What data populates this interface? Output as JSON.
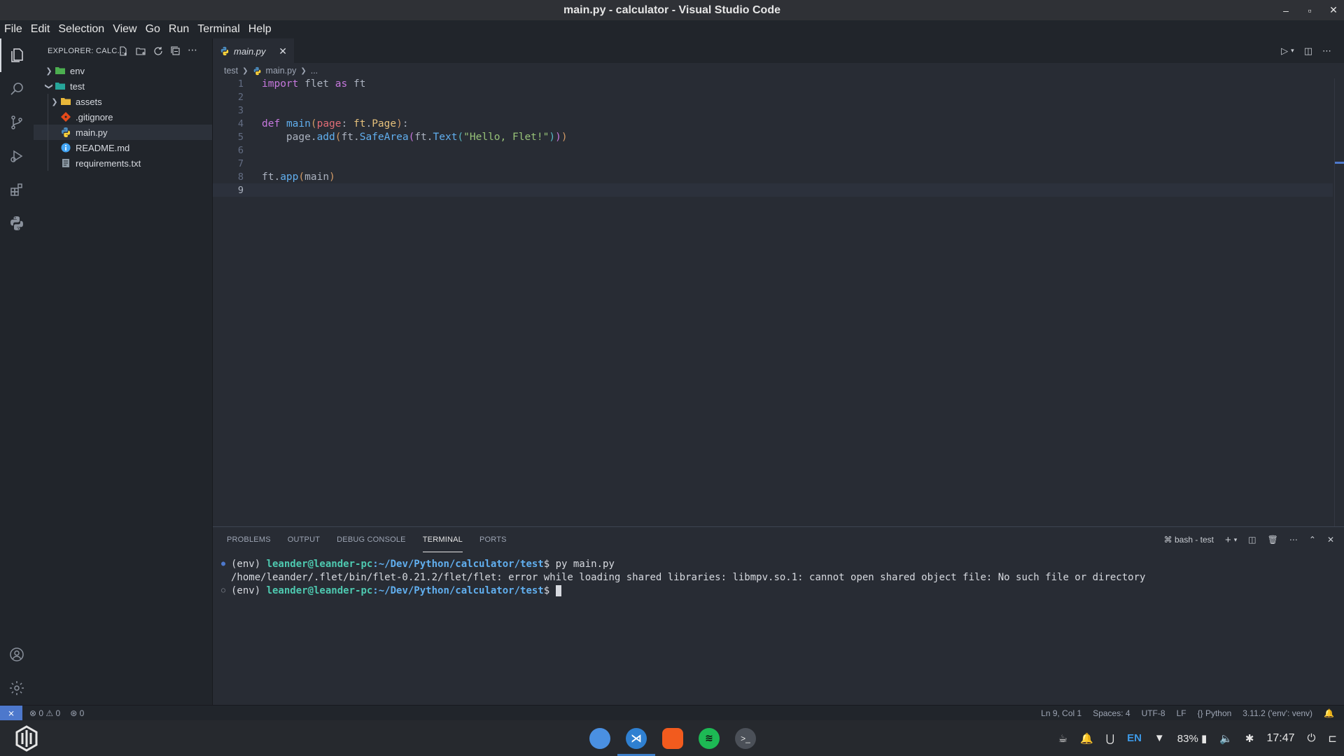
{
  "window": {
    "title": "main.py - calculator - Visual Studio Code",
    "controls": [
      "–",
      "▫",
      "✕"
    ]
  },
  "menu": [
    "File",
    "Edit",
    "Selection",
    "View",
    "Go",
    "Run",
    "Terminal",
    "Help"
  ],
  "sidebar": {
    "header": "EXPLORER: CALC...",
    "items": [
      {
        "label": "env",
        "type": "folder",
        "expanded": false,
        "depth": 0
      },
      {
        "label": "test",
        "type": "folder",
        "expanded": true,
        "depth": 0
      },
      {
        "label": "assets",
        "type": "folder",
        "expanded": false,
        "depth": 1
      },
      {
        "label": ".gitignore",
        "type": "file",
        "depth": 1
      },
      {
        "label": "main.py",
        "type": "file",
        "depth": 1,
        "selected": true
      },
      {
        "label": "README.md",
        "type": "file",
        "depth": 1
      },
      {
        "label": "requirements.txt",
        "type": "file",
        "depth": 1
      }
    ]
  },
  "editor": {
    "tab": {
      "label": "main.py"
    },
    "breadcrumb": {
      "folder": "test",
      "file": "main.py",
      "more": "..."
    },
    "line_numbers": [
      "1",
      "2",
      "3",
      "4",
      "5",
      "6",
      "7",
      "8",
      "9"
    ],
    "current_line": 9
  },
  "panel": {
    "tabs": [
      "PROBLEMS",
      "OUTPUT",
      "DEBUG CONSOLE",
      "TERMINAL",
      "PORTS"
    ],
    "active_tab": "TERMINAL",
    "terminal_name": "bash - test",
    "lines": [
      {
        "env": "(env) ",
        "user": "leander@leander-pc",
        "path": ":~/Dev/Python/calculator/test",
        "prompt": "$ ",
        "cmd": "py main.py"
      },
      {
        "text": "/home/leander/.flet/bin/flet-0.21.2/flet/flet: error while loading shared libraries: libmpv.so.1: cannot open shared object file: No such file or directory"
      },
      {
        "env": "(env) ",
        "user": "leander@leander-pc",
        "path": ":~/Dev/Python/calculator/test",
        "prompt": "$ ",
        "cmd": ""
      }
    ]
  },
  "status": {
    "errors": "0",
    "warnings": "0",
    "ports": "0",
    "position": "Ln 9, Col 1",
    "spaces": "Spaces: 4",
    "encoding": "UTF-8",
    "eol": "LF",
    "language": "Python",
    "interpreter": "3.11.2 ('env': venv)"
  },
  "taskbar": {
    "lang": "EN",
    "battery": "83%",
    "clock": "17:47"
  },
  "colors": {
    "accent": "#4d78cc",
    "folder_green": "#4caf50",
    "folder_yellow": "#e8b73a",
    "python_blue": "#4b8bbe"
  }
}
